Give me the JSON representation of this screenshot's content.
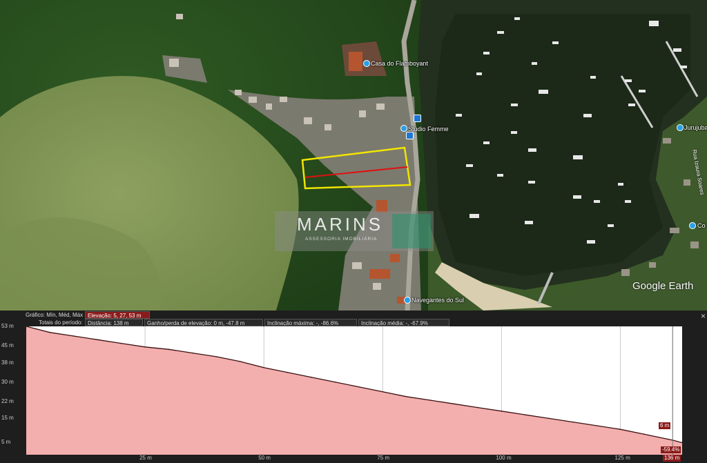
{
  "map": {
    "labels": {
      "casa": "Casa do Flamboyant",
      "studio": "Stúdio Femme",
      "navegantes": "Navegantes do Sul",
      "jurujuba": "Jurujuba",
      "road": "Rua Izaura Soares",
      "outside_right": "Co"
    },
    "watermark": {
      "title": "MARINS",
      "subtitle": "ASSESSORIA IMOBILIÁRIA"
    },
    "google_earth": "Google Earth",
    "colors": {
      "parcel": "#f2e600",
      "profile_line": "#e01010"
    }
  },
  "profile": {
    "graph_label": "Gráfico: Mín, Méd, Máx",
    "elevation": "Elevação: 5, 27, 53 m",
    "totals_label": "Totais do período:",
    "distance": "Distância: 138 m",
    "gain_loss": "Ganho/perda de elevação: 0 m, -47.8 m",
    "max_slope": "Inclinação máxima: -, -86.6%",
    "avg_slope": "Inclinação média: -, -67.9%",
    "close": "×",
    "cursor_elevation": "6 m",
    "cursor_slope": "-59.4%",
    "cursor_distance": "136 m"
  },
  "chart_data": {
    "type": "area",
    "title": "",
    "xlabel": "",
    "ylabel": "",
    "xlim": [
      0,
      138
    ],
    "ylim": [
      0,
      53
    ],
    "yticks": [
      "53 m",
      "45 m",
      "38 m",
      "30 m",
      "22 m",
      "15 m",
      "5 m"
    ],
    "xticks": [
      "25 m",
      "50 m",
      "75 m",
      "100 m",
      "125 m",
      "136 m"
    ],
    "x": [
      0,
      2,
      5,
      10,
      15,
      20,
      25,
      30,
      35,
      40,
      45,
      50,
      55,
      60,
      65,
      70,
      75,
      80,
      85,
      90,
      95,
      100,
      105,
      110,
      115,
      120,
      125,
      130,
      136,
      138
    ],
    "series": [
      {
        "values": [
          53,
          52,
          50.5,
          49,
          47.5,
          46,
          44.5,
          43.5,
          42,
          40.5,
          38.5,
          36,
          34,
          32,
          30,
          28,
          26,
          24,
          22.5,
          21,
          19.5,
          18,
          16.5,
          15,
          13.5,
          12,
          10.5,
          8.5,
          6,
          5
        ],
        "color": "#e01010"
      }
    ],
    "grid": true,
    "fill_color": "#f5c2c2"
  }
}
